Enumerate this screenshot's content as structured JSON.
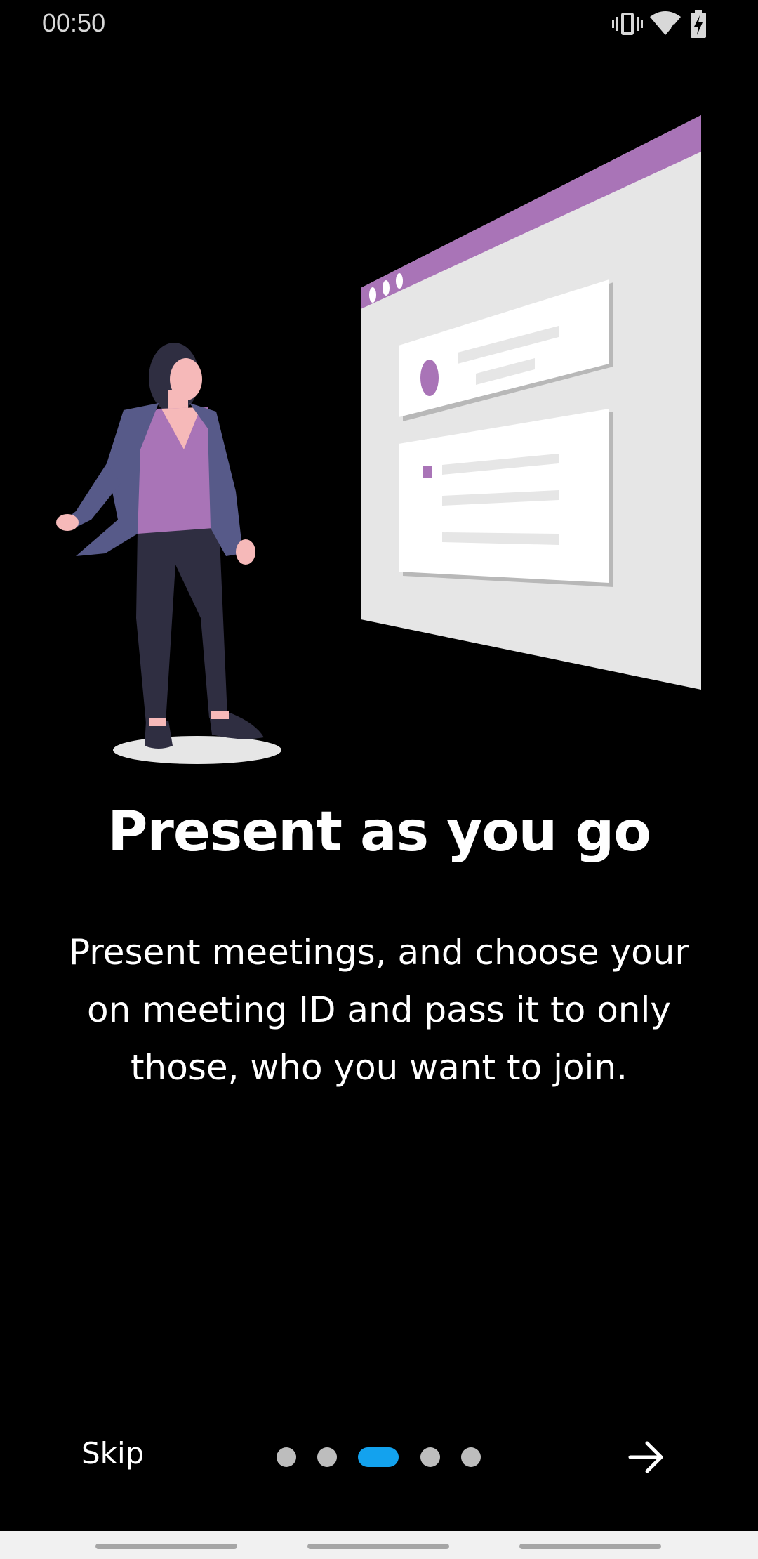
{
  "status_bar": {
    "time": "00:50",
    "icons": [
      "vibrate-icon",
      "wifi-icon",
      "battery-charging-icon"
    ]
  },
  "onboarding": {
    "title": "Present as you go",
    "description": "Present meetings, and choose your on meeting ID and pass it to only those, who you want to join.",
    "illustration": "woman-presenting-browser-window-illustration"
  },
  "navigation": {
    "skip_label": "Skip",
    "page_count": 5,
    "current_page": 3,
    "next_icon": "arrow-right-icon"
  },
  "colors": {
    "background": "#000000",
    "text": "#ffffff",
    "active_dot": "#13a2ee",
    "inactive_dot": "#bdbdbd",
    "accent_purple": "#a974b7"
  }
}
